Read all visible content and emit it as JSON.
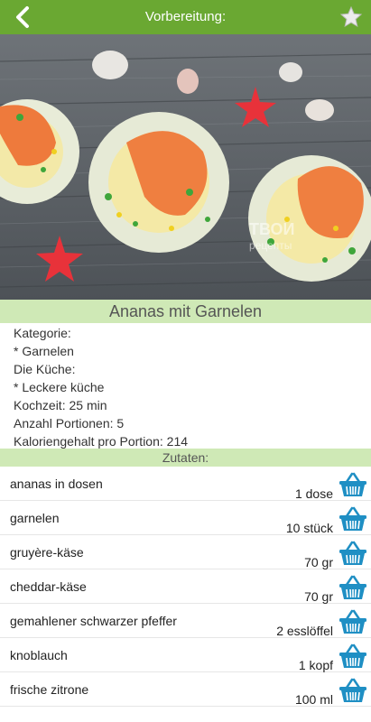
{
  "topbar": {
    "title": "Vorbereitung:",
    "back_icon": "chevron-left-icon",
    "favorite_icon": "star-icon",
    "bar_color": "#6aa832"
  },
  "hero": {
    "watermark_line1": "ТВОИ",
    "watermark_line2": "рецепты"
  },
  "recipe": {
    "title": "Ananas mit Garnelen",
    "info": [
      "Kategorie:",
      "* Garnelen",
      "Die Küche:",
      "* Leckere küche",
      "Kochzeit: 25 min",
      "Anzahl Portionen: 5",
      "Kaloriengehalt pro Portion: 214"
    ]
  },
  "zutaten": {
    "header": "Zutaten:",
    "basket_icon": "basket-icon",
    "items": [
      {
        "name": "ananas in dosen",
        "qty": "1 dose"
      },
      {
        "name": "garnelen",
        "qty": "10 stück"
      },
      {
        "name": "gruyère-käse",
        "qty": "70 gr"
      },
      {
        "name": "cheddar-käse",
        "qty": "70 gr"
      },
      {
        "name": "gemahlener schwarzer pfeffer",
        "qty": "2 esslöffel"
      },
      {
        "name": "knoblauch",
        "qty": "1 kopf"
      },
      {
        "name": "frische zitrone",
        "qty": "100 ml"
      }
    ]
  },
  "colors": {
    "accent": "#6aa832",
    "section_band": "#cfe9b6",
    "basket": "#1f8fc4"
  }
}
